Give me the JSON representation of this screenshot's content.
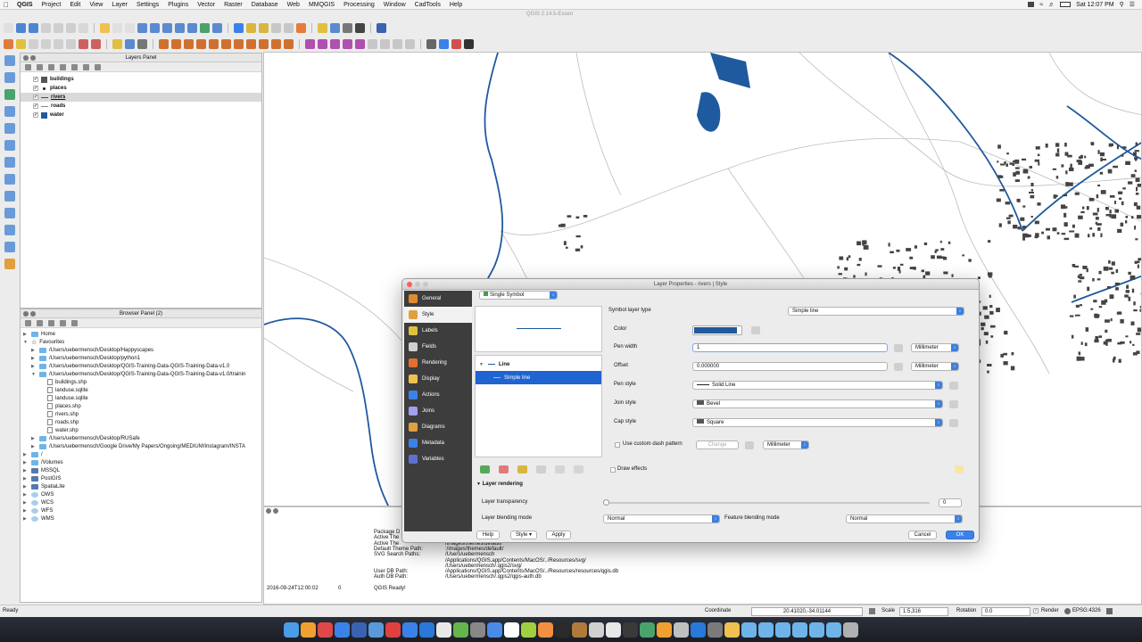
{
  "menubar": {
    "items": [
      "QGIS",
      "Project",
      "Edit",
      "View",
      "Layer",
      "Settings",
      "Plugins",
      "Vector",
      "Raster",
      "Database",
      "Web",
      "MMQGIS",
      "Processing",
      "Window",
      "CadTools",
      "Help"
    ],
    "clock": "Sat 12:07 PM"
  },
  "window_title": "QGIS 2.14.5-Essen",
  "layers_panel": {
    "title": "Layers Panel",
    "layers": [
      {
        "name": "buildings",
        "color": "#555555",
        "selected": false
      },
      {
        "name": "places",
        "color": "#222222",
        "selected": false
      },
      {
        "name": "rivers",
        "color": "#1f5a9e",
        "selected": true
      },
      {
        "name": "roads",
        "color": "#888888",
        "selected": false
      },
      {
        "name": "water",
        "color": "#1f5a9e",
        "selected": false
      }
    ]
  },
  "browser_panel": {
    "title": "Browser Panel (2)",
    "items": [
      {
        "label": "Home",
        "indent": 0,
        "kind": "folder"
      },
      {
        "label": "Favourites",
        "indent": 0,
        "kind": "star"
      },
      {
        "label": "/Users/uebermensch/Desktop/Happyscapes",
        "indent": 1,
        "kind": "folder"
      },
      {
        "label": "/Users/uebermensch/Desktop/python1",
        "indent": 1,
        "kind": "folder"
      },
      {
        "label": "/Users/uebermensch/Desktop/QGIS-Training-Data-QGIS-Training-Data-v1.0",
        "indent": 1,
        "kind": "folder"
      },
      {
        "label": "/Users/uebermensch/Desktop/QGIS-Training-Data-QGIS-Training-Data-v1.0/trainin",
        "indent": 1,
        "kind": "folder"
      },
      {
        "label": "buildings.shp",
        "indent": 2,
        "kind": "file"
      },
      {
        "label": "landuse.sqlite",
        "indent": 2,
        "kind": "file"
      },
      {
        "label": "landuse.sqlite",
        "indent": 2,
        "kind": "file"
      },
      {
        "label": "places.shp",
        "indent": 2,
        "kind": "file"
      },
      {
        "label": "rivers.shp",
        "indent": 2,
        "kind": "file"
      },
      {
        "label": "roads.shp",
        "indent": 2,
        "kind": "file"
      },
      {
        "label": "water.shp",
        "indent": 2,
        "kind": "file"
      },
      {
        "label": "/Users/uebermensch/Desktop/RUSafe",
        "indent": 1,
        "kind": "folder"
      },
      {
        "label": "/Users/uebermensch/Google Drive/My Papers/Ongoing/MEDIUM/Instagram/INSTA",
        "indent": 1,
        "kind": "folder"
      },
      {
        "label": "/",
        "indent": 0,
        "kind": "folder"
      },
      {
        "label": "/Volumes",
        "indent": 0,
        "kind": "folder"
      },
      {
        "label": "MSSQL",
        "indent": 0,
        "kind": "db"
      },
      {
        "label": "PostGIS",
        "indent": 0,
        "kind": "db"
      },
      {
        "label": "SpatiaLite",
        "indent": 0,
        "kind": "db"
      },
      {
        "label": "OWS",
        "indent": 0,
        "kind": "web"
      },
      {
        "label": "WCS",
        "indent": 0,
        "kind": "web"
      },
      {
        "label": "WFS",
        "indent": 0,
        "kind": "web"
      },
      {
        "label": "WMS",
        "indent": 0,
        "kind": "web"
      }
    ]
  },
  "log": {
    "lines": [
      {
        "key": "Package D",
        "value": ""
      },
      {
        "key": "Active The",
        "value": ""
      },
      {
        "key": "Active The",
        "value": "/images/themes/default/"
      },
      {
        "key": "Default Theme Path:",
        "value": ":/images/themes/default/"
      },
      {
        "key": "SVG Search Paths:",
        "value": "/Users/uebermensch"
      },
      {
        "key": "",
        "value": "/Applications/QGIS.app/Contents/MacOS/../Resources/svg/"
      },
      {
        "key": "",
        "value": "/Users/uebermensch/.qgis2/svg/"
      },
      {
        "key": "User DB Path:",
        "value": "/Applications/QGIS.app/Contents/MacOS/../Resources/resources/qgis.db"
      },
      {
        "key": "Auth DB Path:",
        "value": "/Users/uebermensch/.qgis2/qgis-auth.db"
      }
    ],
    "timestamp": "2016-09-24T12:00:02",
    "level": "0",
    "message": "QGIS Ready!"
  },
  "statusbar": {
    "ready": "Ready",
    "coordinate_label": "Coordinate",
    "coordinate": "20.41020,-34.01144",
    "scale_label": "Scale",
    "scale": "1:5,316",
    "rotation_label": "Rotation",
    "rotation": "0.0",
    "render_label": "Render",
    "epsg": "EPSG:4326"
  },
  "dialog": {
    "title": "Layer Properties - rivers | Style",
    "sidebar": [
      "General",
      "Style",
      "Labels",
      "Fields",
      "Rendering",
      "Display",
      "Actions",
      "Joins",
      "Diagrams",
      "Metadata",
      "Variables"
    ],
    "active_tab": "Style",
    "renderer": "Single Symbol",
    "tree_line": "Line",
    "tree_simple": "Simple line",
    "symbol_layer_type_label": "Symbol layer type",
    "symbol_layer_type": "Simple line",
    "color_label": "Color",
    "color": "#1f5a9e",
    "pen_width_label": "Pen width",
    "pen_width": "1",
    "pen_width_unit": "Millimeter",
    "offset_label": "Offset",
    "offset": "0.000000",
    "offset_unit": "Millimeter",
    "pen_style_label": "Pen style",
    "pen_style": "Solid Line",
    "join_style_label": "Join style",
    "join_style": "Bevel",
    "cap_style_label": "Cap style",
    "cap_style": "Square",
    "custom_dash_label": "Use custom dash pattern",
    "change_label": "Change",
    "dash_unit": "Millimeter",
    "draw_effects_label": "Draw effects",
    "layer_rendering_label": "Layer rendering",
    "layer_transparency_label": "Layer transparency",
    "layer_transparency": "0",
    "layer_blending_label": "Layer blending mode",
    "layer_blending": "Normal",
    "feature_blending_label": "Feature blending mode",
    "feature_blending": "Normal",
    "help": "Help",
    "style_menu": "Style",
    "apply": "Apply",
    "cancel": "Cancel",
    "ok": "OK"
  }
}
